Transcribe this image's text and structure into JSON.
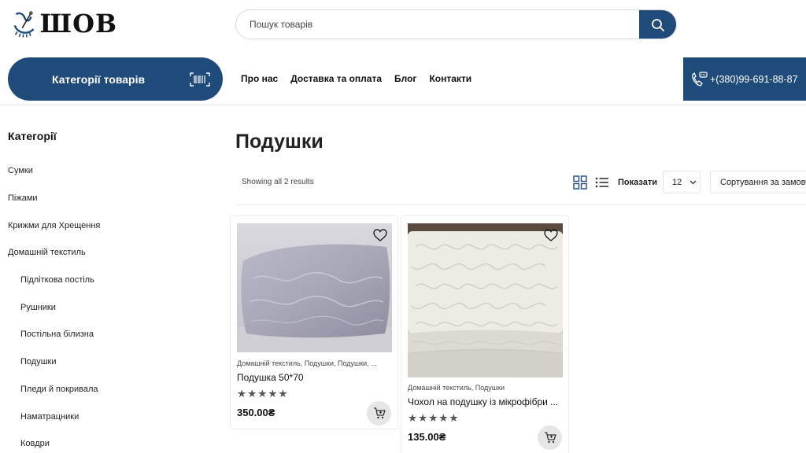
{
  "header": {
    "logo_text": "ШОВ",
    "search_placeholder": "Пошук товарів"
  },
  "nav": {
    "categories_button": "Категорії товарів",
    "menu": [
      "Про нас",
      "Доставка та оплата",
      "Блог",
      "Контакти"
    ],
    "phone": "+(380)99-691-88-87"
  },
  "sidebar": {
    "title": "Категорії",
    "items": [
      {
        "label": "Сумки",
        "level": 0
      },
      {
        "label": "Піжами",
        "level": 0
      },
      {
        "label": "Крижми для Хрещення",
        "level": 0
      },
      {
        "label": "Домашній текстиль",
        "level": 0
      },
      {
        "label": "Підліткова постіль",
        "level": 1
      },
      {
        "label": "Рушники",
        "level": 1
      },
      {
        "label": "Постільна білизна",
        "level": 1
      },
      {
        "label": "Подушки",
        "level": 1
      },
      {
        "label": "Пледи й покривала",
        "level": 1
      },
      {
        "label": "Наматрацники",
        "level": 1
      },
      {
        "label": "Ковдри",
        "level": 1
      }
    ]
  },
  "main": {
    "title": "Подушки",
    "results_text": "Showing all 2 results",
    "show_label": "Показати",
    "per_page": "12",
    "sort_label": "Сортування за замовчуванням",
    "icons": {
      "search": "search-icon",
      "barcode": "barcode-icon",
      "phone": "phone-icon",
      "grid_view": "grid-view-icon",
      "list_view": "list-view-icon",
      "wishlist": "heart-icon",
      "cart": "cart-icon"
    },
    "colors": {
      "accent": "#1f4b7a"
    }
  },
  "products": [
    {
      "categories": "Домашній текстиль, Подушки, Подушки, ...",
      "title": "Подушка 50*70",
      "rating": 5,
      "price": "350.00₴"
    },
    {
      "categories": "Домашній текстиль, Подушки",
      "title": "Чохол на подушку із мікрофібри ...",
      "rating": 5,
      "price": "135.00₴"
    }
  ]
}
